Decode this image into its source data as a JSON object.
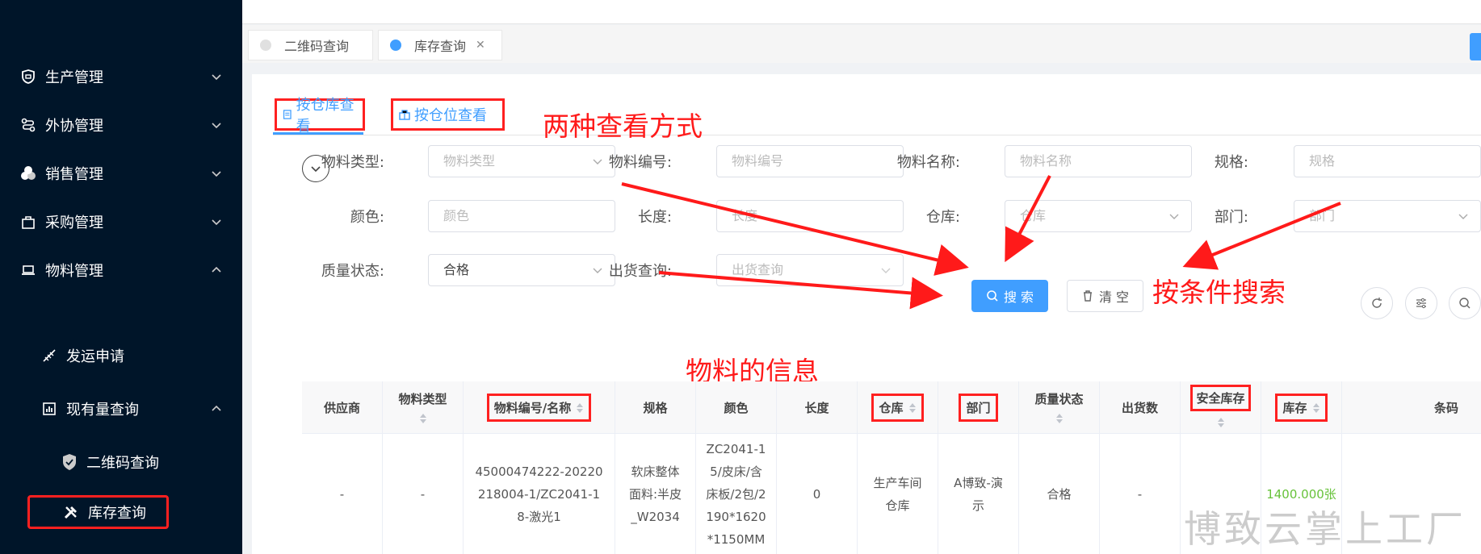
{
  "sidebar": {
    "items": [
      {
        "label": "生产管理",
        "icon": "shield-icon"
      },
      {
        "label": "外协管理",
        "icon": "route-icon"
      },
      {
        "label": "销售管理",
        "icon": "coins-icon"
      },
      {
        "label": "采购管理",
        "icon": "bag-icon"
      },
      {
        "label": "物料管理",
        "icon": "laptop-icon"
      }
    ],
    "sub_items": [
      {
        "label": "发运申请",
        "icon": "ship-icon"
      },
      {
        "label": "现有量查询",
        "icon": "chart-icon"
      }
    ],
    "sub2_items": [
      {
        "label": "二维码查询",
        "icon": "shield-check-icon"
      },
      {
        "label": "库存查询",
        "icon": "tools-icon"
      }
    ]
  },
  "tabs": [
    {
      "label": "二维码查询"
    },
    {
      "label": "库存查询"
    }
  ],
  "view_tabs": [
    {
      "label": "按仓库查看"
    },
    {
      "label": "按仓位查看"
    }
  ],
  "annotations": {
    "views": "两种查看方式",
    "search": "按条件搜索",
    "info": "物料的信息"
  },
  "filters": {
    "material_type": {
      "label": "物料类型:",
      "placeholder": "物料类型"
    },
    "material_code": {
      "label": "物料编号:",
      "placeholder": "物料编号"
    },
    "material_name": {
      "label": "物料名称:",
      "placeholder": "物料名称"
    },
    "spec": {
      "label": "规格:",
      "placeholder": "规格"
    },
    "color": {
      "label": "颜色:",
      "placeholder": "颜色"
    },
    "length": {
      "label": "长度:",
      "placeholder": "长度"
    },
    "warehouse": {
      "label": "仓库:",
      "placeholder": "仓库"
    },
    "department": {
      "label": "部门:",
      "placeholder": "部门"
    },
    "quality": {
      "label": "质量状态:",
      "value": "合格"
    },
    "shipment": {
      "label": "出货查询:",
      "placeholder": "出货查询"
    }
  },
  "buttons": {
    "search": "搜 索",
    "clear": "清 空"
  },
  "table": {
    "headers": [
      "供应商",
      "物料类型",
      "物料编号/名称",
      "规格",
      "颜色",
      "长度",
      "仓库",
      "部门",
      "质量状态",
      "出货数",
      "安全库存",
      "库存",
      "条码"
    ],
    "row": [
      "-",
      "-",
      "45000474222-20220218004-1/ZC2041-18-激光1",
      "软床整体面料:半皮_W2034",
      "ZC2041-15/皮床/含床板/2包/2190*1620*1150MM",
      "0",
      "生产车间仓库",
      "A博致-演示",
      "合格",
      "-",
      "",
      "1400.000张",
      ""
    ]
  },
  "watermark": "博致云掌上工厂",
  "colors": {
    "accent": "#409eff",
    "annotation": "#ff2020",
    "sidebar": "#001529",
    "stock_green": "#67c23a"
  }
}
